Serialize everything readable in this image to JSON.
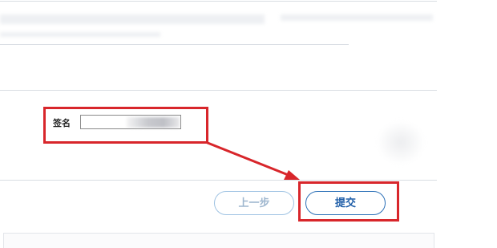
{
  "form": {
    "signature_label": "签名",
    "signature_value": "",
    "signature_placeholder": ""
  },
  "buttons": {
    "prev_label": "上一步",
    "submit_label": "提交"
  },
  "colors": {
    "highlight_red": "#d8262b",
    "submit_blue": "#1f5ea8",
    "prev_blue": "#9fb7cf"
  },
  "icons": {
    "annotation_arrow": "arrow-icon"
  }
}
